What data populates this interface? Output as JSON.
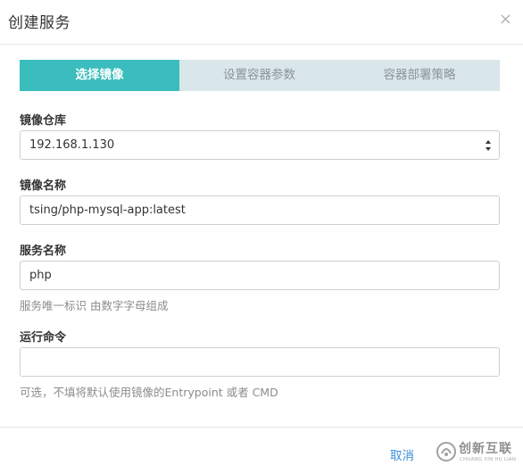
{
  "dialog": {
    "title": "创建服务",
    "close_icon": "×"
  },
  "steps": [
    {
      "label": "选择镜像",
      "active": true
    },
    {
      "label": "设置容器参数",
      "active": false
    },
    {
      "label": "容器部署策略",
      "active": false
    }
  ],
  "form": {
    "registry": {
      "label": "镜像仓库",
      "value": "192.168.1.130"
    },
    "image_name": {
      "label": "镜像名称",
      "value": "tsing/php-mysql-app:latest"
    },
    "service_name": {
      "label": "服务名称",
      "value": "php",
      "help": "服务唯一标识 由数字字母组成"
    },
    "run_command": {
      "label": "运行命令",
      "value": "",
      "help": "可选，不填将默认使用镜像的Entrypoint 或者 CMD"
    }
  },
  "footer": {
    "cancel_label": "取消"
  },
  "watermark": {
    "text": "创新互联",
    "subtext": "CHUANG XIN HU LIAN"
  },
  "colors": {
    "accent": "#3cbdbd",
    "step_inactive_bg": "#d9e6ea",
    "link": "#3a8fd8"
  }
}
